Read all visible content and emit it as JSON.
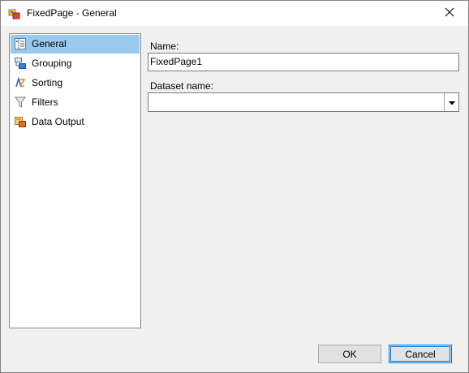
{
  "window": {
    "title": "FixedPage - General"
  },
  "nav": {
    "items": [
      {
        "label": "General",
        "icon": "general-properties-icon",
        "selected": true
      },
      {
        "label": "Grouping",
        "icon": "grouping-icon",
        "selected": false
      },
      {
        "label": "Sorting",
        "icon": "sorting-icon",
        "selected": false
      },
      {
        "label": "Filters",
        "icon": "filter-funnel-icon",
        "selected": false
      },
      {
        "label": "Data Output",
        "icon": "data-output-icon",
        "selected": false
      }
    ]
  },
  "form": {
    "name_label": "Name:",
    "name_value": "FixedPage1",
    "dataset_label": "Dataset name:",
    "dataset_value": ""
  },
  "buttons": {
    "ok_label": "OK",
    "cancel_label": "Cancel"
  },
  "colors": {
    "selection": "#99c9ef",
    "accent": "#0078d7"
  }
}
